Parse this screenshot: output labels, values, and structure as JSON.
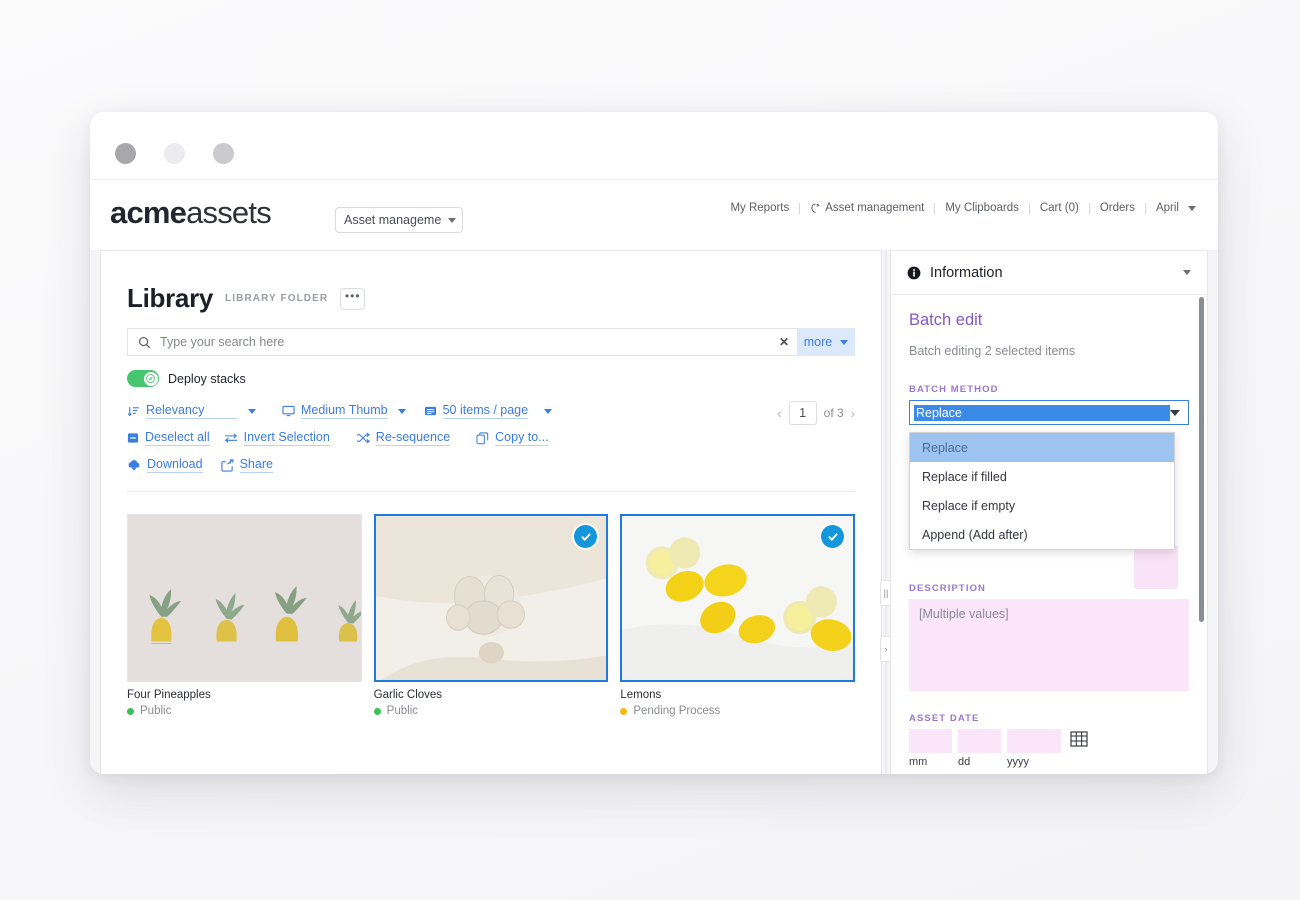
{
  "window": {
    "traffic_lights": [
      "close",
      "minimize",
      "maximize"
    ]
  },
  "header": {
    "brand_bold": "acme",
    "brand_light": "assets",
    "context_selector": {
      "value": "Asset manageme",
      "icon": "chevron-down-icon"
    },
    "nav": [
      {
        "label": "My Reports",
        "icon": ""
      },
      {
        "label": "Asset management",
        "icon": "asset-management-icon"
      },
      {
        "label": "My Clipboards",
        "icon": ""
      },
      {
        "label": "Cart (0)",
        "icon": ""
      },
      {
        "label": "Orders",
        "icon": ""
      },
      {
        "label": "April",
        "icon": "chevron-down-icon"
      }
    ]
  },
  "library": {
    "title": "Library",
    "kind": "LIBRARY FOLDER",
    "kebab_label": "•••",
    "search": {
      "placeholder": "Type your search here",
      "value": "",
      "clear_label": "✕",
      "more_label": "more",
      "search_icon": "search-icon"
    },
    "deploy_stacks": {
      "label": "Deploy stacks",
      "enabled": true,
      "on_color": "#46c66f"
    },
    "controls_row1": [
      {
        "label": "Relevancy",
        "icon": "sort-icon",
        "caret": true
      },
      {
        "label": "Medium Thumb",
        "icon": "monitor-icon",
        "caret": true
      },
      {
        "label": "50 items / page",
        "icon": "list-icon",
        "caret": true
      }
    ],
    "controls_row2": [
      {
        "label": "Deselect all",
        "icon": "deselect-icon"
      },
      {
        "label": "Invert Selection",
        "icon": "invert-icon"
      },
      {
        "label": "Re-sequence",
        "icon": "shuffle-icon"
      },
      {
        "label": "Copy to...",
        "icon": "copy-icon"
      }
    ],
    "controls_row3": [
      {
        "label": "Download",
        "icon": "cloud-download-icon"
      },
      {
        "label": "Share",
        "icon": "share-icon"
      }
    ],
    "pager": {
      "prev": "‹",
      "page": "1",
      "of_label": "of 3",
      "next": "›"
    }
  },
  "assets": [
    {
      "name": "Four Pineapples",
      "status": "Public",
      "status_color": "#3cc057",
      "selected": false
    },
    {
      "name": "Garlic Cloves",
      "status": "Public",
      "status_color": "#3cc057",
      "selected": true
    },
    {
      "name": "Lemons",
      "status": "Pending Process",
      "status_color": "#f5b914",
      "selected": true
    }
  ],
  "splitter": {
    "grip_label": "||",
    "collapse_label": "›"
  },
  "info_panel": {
    "header": {
      "title": "Information",
      "icon": "info-icon",
      "collapse_icon": "chevron-down-icon"
    },
    "batch_title": "Batch edit",
    "batch_subtitle": "Batch editing 2 selected items",
    "batch_method": {
      "label": "BATCH METHOD",
      "value": "Replace",
      "open": true,
      "options": [
        {
          "label": "Replace",
          "highlighted": true
        },
        {
          "label": "Replace if filled",
          "highlighted": false
        },
        {
          "label": "Replace if empty",
          "highlighted": false
        },
        {
          "label": "Append (Add after)",
          "highlighted": false
        }
      ]
    },
    "description": {
      "label": "DESCRIPTION",
      "value": "[Multiple values]"
    },
    "asset_date": {
      "label": "ASSET DATE",
      "mm": "",
      "dd": "",
      "yyyy": "",
      "cap_mm": "mm",
      "cap_dd": "dd",
      "cap_yyyy": "yyyy",
      "calendar_icon": "calendar-icon"
    }
  },
  "colors": {
    "accent_blue": "#3b7de0",
    "purple_label": "#9a78cf",
    "pink_field": "#fae6f8",
    "toggle_green": "#46c66f",
    "check_blue": "#1496dd"
  }
}
